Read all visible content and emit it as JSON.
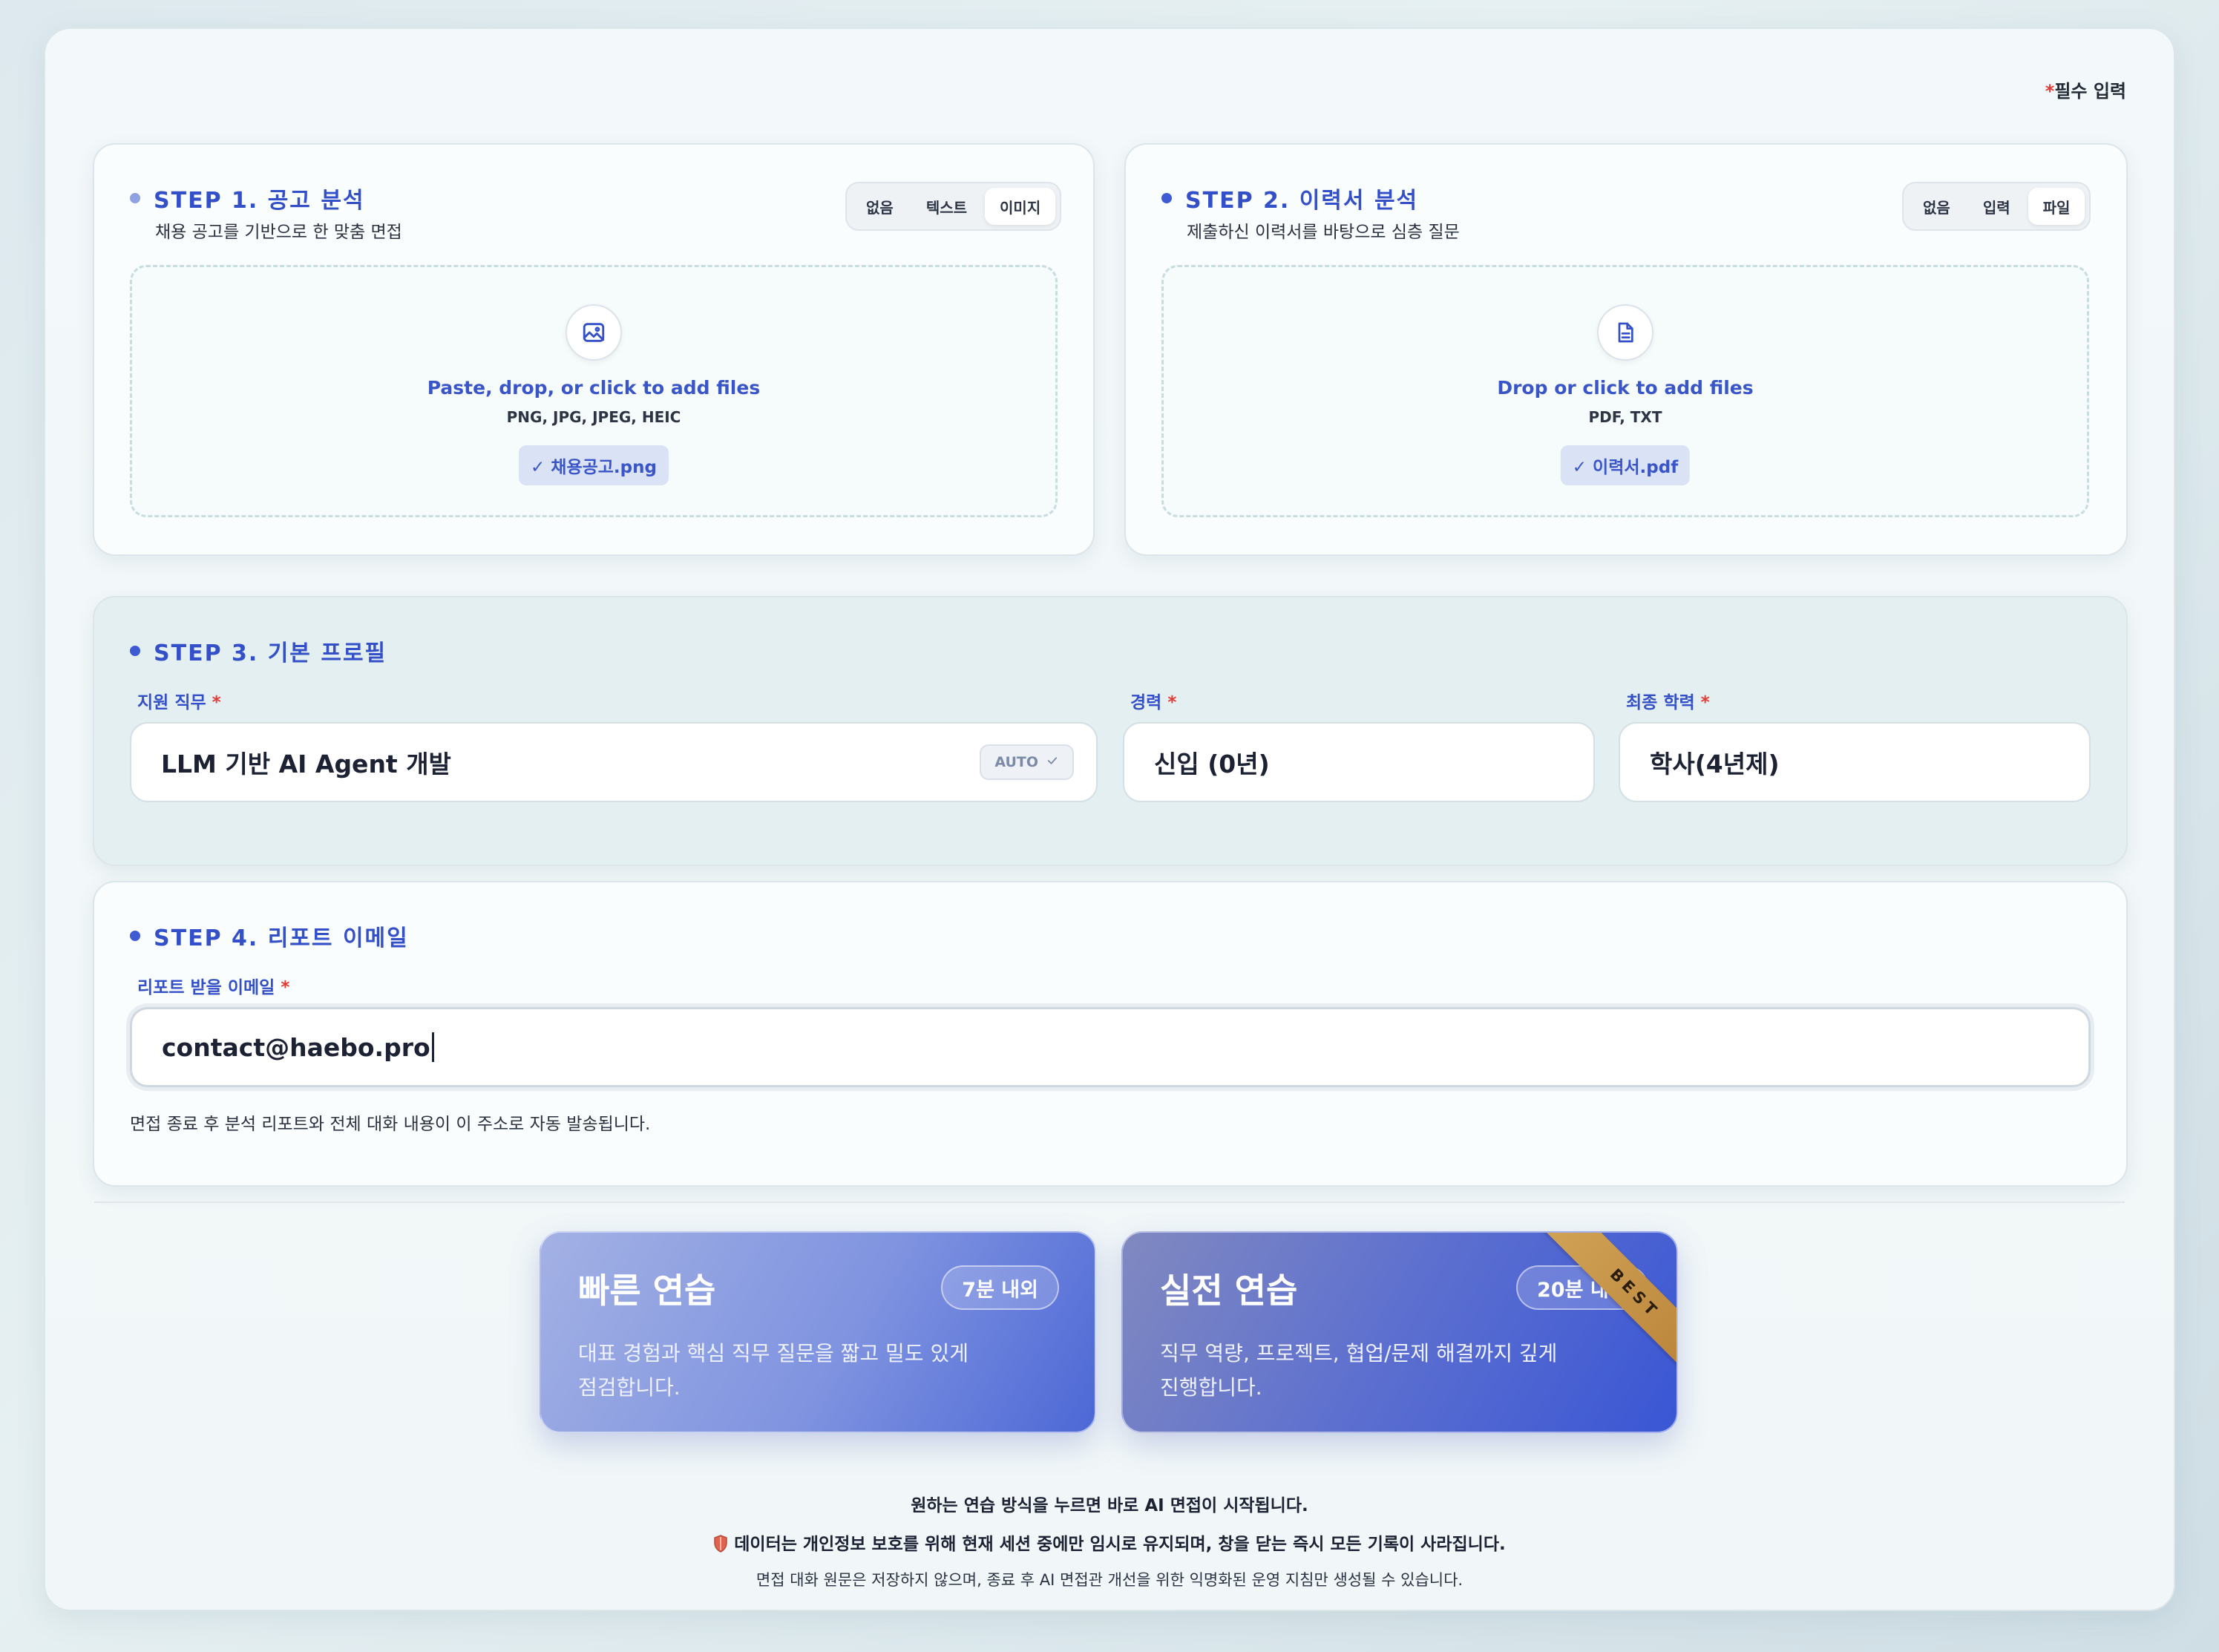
{
  "required_note": {
    "star": "*",
    "label": "필수 입력"
  },
  "step1": {
    "title": "STEP 1. 공고 분석",
    "subtitle": "채용 공고를 기반으로 한 맞춤 면접",
    "options": [
      "없음",
      "텍스트",
      "이미지"
    ],
    "active_option": "이미지",
    "drop_main": "Paste, drop, or click to add files",
    "drop_types": "PNG, JPG, JPEG, HEIC",
    "file_chip": "✓ 채용공고.png",
    "icon": "image-icon"
  },
  "step2": {
    "title": "STEP 2. 이력서 분석",
    "subtitle": "제출하신 이력서를 바탕으로 심층 질문",
    "options": [
      "없음",
      "입력",
      "파일"
    ],
    "active_option": "파일",
    "drop_main": "Drop or click to add files",
    "drop_types": "PDF, TXT",
    "file_chip": "✓ 이력서.pdf",
    "icon": "document-icon"
  },
  "step3": {
    "title": "STEP 3. 기본 프로필",
    "job_label": "지원 직무",
    "job_value": "LLM 기반 AI Agent 개발",
    "auto_badge": "AUTO",
    "career_label": "경력",
    "career_value": "신입 (0년)",
    "edu_label": "최종 학력",
    "edu_value": "학사(4년제)",
    "required_star": "*"
  },
  "step4": {
    "title": "STEP 4. 리포트 이메일",
    "email_label": "리포트 받을 이메일",
    "email_value": "contact@haebo.pro",
    "hint": "면접 종료 후 분석 리포트와 전체 대화 내용이 이 주소로 자동 발송됩니다.",
    "required_star": "*"
  },
  "modes": {
    "quick": {
      "title": "빠른 연습",
      "time": "7분 내외",
      "desc_line1": "대표 경험과 핵심 직무 질문을 짧고 밀도 있게",
      "desc_line2": "점검합니다."
    },
    "real": {
      "title": "실전 연습",
      "time": "20분 내외",
      "desc_line1": "직무 역량, 프로젝트, 협업/문제 해결까지 깊게",
      "desc_line2": "진행합니다.",
      "ribbon": "BEST"
    }
  },
  "notices": {
    "start": "원하는 연습 방식을 누르면 바로 AI 면접이 시작됩니다.",
    "privacy": "데이터는 개인정보 보호를 위해 현재 세션 중에만 임시로 유지되며, 창을 닫는 즉시 모든 기록이 사라집니다.",
    "policy": "면접 대화 원문은 저장하지 않으며, 종료 후 AI 면접관 개선을 위한 익명화된 운영 지침만 생성될 수 있습니다."
  },
  "colors": {
    "accent": "#3450c9",
    "required": "#e53935",
    "ribbon": "#c8964a"
  }
}
